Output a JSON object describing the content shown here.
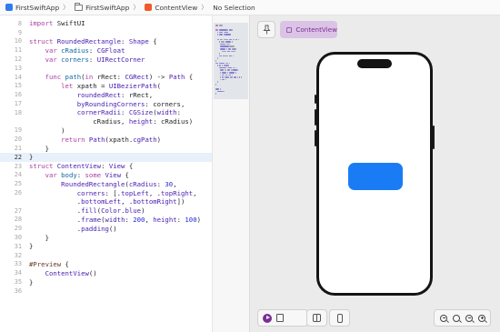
{
  "breadcrumb": [
    {
      "label": "FirstSwiftApp",
      "icon": "app-icon"
    },
    {
      "label": "FirstSwiftApp",
      "icon": "folder-icon"
    },
    {
      "label": "ContentView",
      "icon": "swift-file-icon"
    },
    {
      "label": "No Selection",
      "icon": ""
    }
  ],
  "editor": {
    "active_line": 22,
    "lines": [
      {
        "n": "8",
        "tokens": [
          [
            "import",
            "kw"
          ],
          [
            " SwiftUI",
            "plain"
          ]
        ]
      },
      {
        "n": "9",
        "tokens": []
      },
      {
        "n": "10",
        "tokens": [
          [
            "struct",
            "kw"
          ],
          [
            " RoundedRectangle",
            "type"
          ],
          [
            ": ",
            "plain"
          ],
          [
            "Shape",
            "type"
          ],
          [
            " {",
            "plain"
          ]
        ]
      },
      {
        "n": "11",
        "tokens": [
          [
            "    var",
            "kw"
          ],
          [
            " cRadius",
            "ident"
          ],
          [
            ": ",
            "plain"
          ],
          [
            "CGFloat",
            "type"
          ]
        ]
      },
      {
        "n": "12",
        "tokens": [
          [
            "    var",
            "kw"
          ],
          [
            " corners",
            "ident"
          ],
          [
            ": ",
            "plain"
          ],
          [
            "UIRectCorner",
            "type"
          ]
        ]
      },
      {
        "n": "13",
        "tokens": []
      },
      {
        "n": "14",
        "tokens": [
          [
            "    func",
            "kw"
          ],
          [
            " path",
            "ident"
          ],
          [
            "(",
            "plain"
          ],
          [
            "in",
            "kw"
          ],
          [
            " rRect: ",
            "plain"
          ],
          [
            "CGRect",
            "type"
          ],
          [
            ") -> ",
            "plain"
          ],
          [
            "Path",
            "type"
          ],
          [
            " {",
            "plain"
          ]
        ]
      },
      {
        "n": "15",
        "tokens": [
          [
            "        let",
            "kw"
          ],
          [
            " xpath = ",
            "plain"
          ],
          [
            "UIBezierPath",
            "type"
          ],
          [
            "(",
            "plain"
          ]
        ]
      },
      {
        "n": "16",
        "tokens": [
          [
            "            roundedRect",
            "type"
          ],
          [
            ": rRect,",
            "plain"
          ]
        ]
      },
      {
        "n": "17",
        "tokens": [
          [
            "            byRoundingCorners",
            "type"
          ],
          [
            ": corners,",
            "plain"
          ]
        ]
      },
      {
        "n": "18",
        "tokens": [
          [
            "            cornerRadii",
            "type"
          ],
          [
            ": ",
            "plain"
          ],
          [
            "CGSize",
            "type"
          ],
          [
            "(",
            "plain"
          ],
          [
            "width",
            "type"
          ],
          [
            ":",
            "plain"
          ]
        ]
      },
      {
        "n": "",
        "tokens": [
          [
            "                cRadius, ",
            "plain"
          ],
          [
            "height",
            "type"
          ],
          [
            ": cRadius)",
            "plain"
          ]
        ]
      },
      {
        "n": "19",
        "tokens": [
          [
            "        )",
            "plain"
          ]
        ]
      },
      {
        "n": "20",
        "tokens": [
          [
            "        return",
            "kw"
          ],
          [
            " ",
            "plain"
          ],
          [
            "Path",
            "type"
          ],
          [
            "(xpath.",
            "plain"
          ],
          [
            "cgPath",
            "type"
          ],
          [
            ")",
            "plain"
          ]
        ]
      },
      {
        "n": "21",
        "tokens": [
          [
            "    }",
            "plain"
          ]
        ]
      },
      {
        "n": "22",
        "tokens": [
          [
            "}",
            "plain"
          ]
        ]
      },
      {
        "n": "23",
        "tokens": [
          [
            "struct",
            "kw"
          ],
          [
            " ContentView",
            "type"
          ],
          [
            ": ",
            "plain"
          ],
          [
            "View",
            "type"
          ],
          [
            " {",
            "plain"
          ]
        ]
      },
      {
        "n": "24",
        "tokens": [
          [
            "    var",
            "kw"
          ],
          [
            " body",
            "ident"
          ],
          [
            ": ",
            "plain"
          ],
          [
            "some",
            "kw"
          ],
          [
            " ",
            "plain"
          ],
          [
            "View",
            "type"
          ],
          [
            " {",
            "plain"
          ]
        ]
      },
      {
        "n": "25",
        "tokens": [
          [
            "        RoundedRectangle",
            "type"
          ],
          [
            "(",
            "plain"
          ],
          [
            "cRadius",
            "type"
          ],
          [
            ": ",
            "plain"
          ],
          [
            "30",
            "num"
          ],
          [
            ",",
            "plain"
          ]
        ]
      },
      {
        "n": "26",
        "tokens": [
          [
            "            corners",
            "type"
          ],
          [
            ": [.",
            "plain"
          ],
          [
            "topLeft",
            "type"
          ],
          [
            ", .",
            "plain"
          ],
          [
            "topRight",
            "type"
          ],
          [
            ",",
            "plain"
          ]
        ]
      },
      {
        "n": "",
        "tokens": [
          [
            "            .",
            "plain"
          ],
          [
            "bottomLeft",
            "type"
          ],
          [
            ", .",
            "plain"
          ],
          [
            "bottomRight",
            "type"
          ],
          [
            "])",
            "plain"
          ]
        ]
      },
      {
        "n": "27",
        "tokens": [
          [
            "            .",
            "plain"
          ],
          [
            "fill",
            "type"
          ],
          [
            "(",
            "plain"
          ],
          [
            "Color",
            "type"
          ],
          [
            ".",
            "plain"
          ],
          [
            "blue",
            "type"
          ],
          [
            ")",
            "plain"
          ]
        ]
      },
      {
        "n": "28",
        "tokens": [
          [
            "            .",
            "plain"
          ],
          [
            "frame",
            "type"
          ],
          [
            "(",
            "plain"
          ],
          [
            "width",
            "type"
          ],
          [
            ": ",
            "plain"
          ],
          [
            "200",
            "num"
          ],
          [
            ", ",
            "plain"
          ],
          [
            "height",
            "type"
          ],
          [
            ": ",
            "plain"
          ],
          [
            "100",
            "num"
          ],
          [
            ")",
            "plain"
          ]
        ]
      },
      {
        "n": "29",
        "tokens": [
          [
            "            .",
            "plain"
          ],
          [
            "padding",
            "type"
          ],
          [
            "()",
            "plain"
          ]
        ]
      },
      {
        "n": "30",
        "tokens": [
          [
            "    }",
            "plain"
          ]
        ]
      },
      {
        "n": "31",
        "tokens": [
          [
            "}",
            "plain"
          ]
        ]
      },
      {
        "n": "32",
        "tokens": []
      },
      {
        "n": "33",
        "tokens": [
          [
            "#Preview",
            "macro"
          ],
          [
            " {",
            "plain"
          ]
        ]
      },
      {
        "n": "34",
        "tokens": [
          [
            "    ContentView",
            "type"
          ],
          [
            "()",
            "plain"
          ]
        ]
      },
      {
        "n": "35",
        "tokens": [
          [
            "}",
            "plain"
          ]
        ]
      },
      {
        "n": "36",
        "tokens": []
      }
    ]
  },
  "syntax_colors": {
    "kw": "#ad3da4",
    "type": "#4b21b0",
    "ident": "#0f68a0",
    "num": "#272ad8",
    "macro": "#643820",
    "plain": "#1f1f1f"
  },
  "preview": {
    "pin_icon": "pin-icon",
    "canvas_button_label": "ContentView",
    "canvas_button_icon": "cube-icon",
    "shape_color": "#1a7cf5"
  },
  "toolbars": {
    "left": [
      "live-preview-icon",
      "selectable-icon"
    ],
    "middle": [
      "variants-icon",
      "device-settings-icon"
    ],
    "right": [
      "zoom-out-icon",
      "zoom-fit-icon",
      "zoom-100-icon",
      "zoom-in-icon"
    ]
  },
  "accent_colors": {
    "preview_purple": "#7a2f94",
    "preview_chip_bg": "#dbc3e6"
  }
}
